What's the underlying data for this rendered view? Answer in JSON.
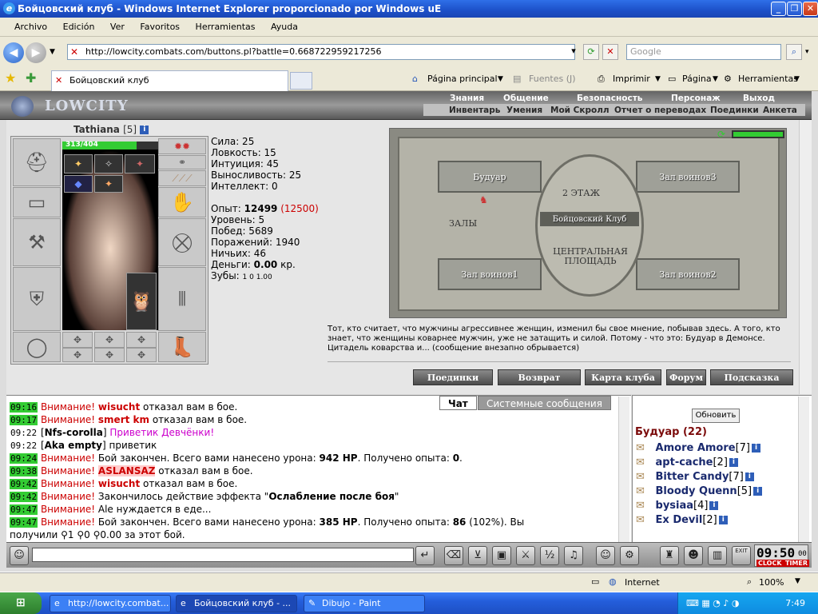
{
  "window": {
    "title": "Бойцовский клуб - Windows Internet Explorer proporcionado por Windows uE"
  },
  "menu": [
    "Archivo",
    "Edición",
    "Ver",
    "Favoritos",
    "Herramientas",
    "Ayuda"
  ],
  "address": {
    "url": "http://lowcity.combats.com/buttons.pl?battle=0.668722959217256",
    "search_placeholder": "Google"
  },
  "tab": {
    "label": "Бойцовский клуб"
  },
  "commandbar": {
    "home": "Página principal",
    "feeds": "Fuentes (J)",
    "print": "Imprimir",
    "page": "Página",
    "tools": "Herramientas"
  },
  "game": {
    "logo": "LOWCITY",
    "topnav": [
      "Знания",
      "Общение",
      "Безопасность",
      "Персонаж",
      "Выход"
    ],
    "subnav": [
      "Инвентарь",
      "Умения",
      "Мой Скролл",
      "Отчет о переводах",
      "Поединки",
      "Анкета"
    ],
    "character": {
      "name": "Tathiana",
      "level": "[5]",
      "hp": "313/404",
      "hp_fraction": 0.775
    },
    "stats": {
      "strength": "Сила: 25",
      "agility": "Ловкость: 15",
      "intuition": "Интуиция: 45",
      "endurance": "Выносливость: 25",
      "intellect": "Интеллект: 0",
      "exp_label": "Опыт:",
      "exp_value": "12499",
      "exp_next": "(12500)",
      "level": "Уровень: 5",
      "wins": "Побед: 5689",
      "losses": "Поражений: 1940",
      "draws": "Ничьих: 46",
      "money_label": "Деньги:",
      "money_value": "0.00",
      "money_unit": "кр.",
      "teeth_label": "Зубы:",
      "teeth_values": "1 0 1.00"
    },
    "map": {
      "rooms": [
        "Будуар",
        "Зал воинов3",
        "2 ЭТАЖ",
        "Бойцовский Клуб",
        "ЗАЛЫ",
        "ЦЕНТРАЛЬНАЯ ПЛОЩАДЬ",
        "Зал воинов1",
        "Зал воинов2"
      ]
    },
    "lore": "Тот, кто считает, что мужчины агрессивнее женщин, изменил бы свое мнение, побывав здесь. А того, кто знает, что женщины коварнее мужчин, уже не затащить и силой. Потому - что это: Будуар в Демонсе. Цитадель коварства и... (сообщение внезапно обрывается)",
    "buttons": [
      "Поединки",
      "Возврат",
      "Карта клуба",
      "Форум",
      "Подсказка"
    ]
  },
  "chat": {
    "tabs": [
      "Чат",
      "Системные сообщения"
    ],
    "lines": [
      {
        "time": "09:16",
        "warn": "Внимание!",
        "nick": "wisucht",
        "text": " отказал вам в бое."
      },
      {
        "time": "09:17",
        "warn": "Внимание!",
        "nick": "smert km",
        "text": " отказал вам в бое."
      },
      {
        "time": "09:22",
        "from": "Nfs-corolla",
        "text": " Приветик Девчёнки!"
      },
      {
        "time": "09:22",
        "from": "Aka empty",
        "text": " приветик"
      },
      {
        "time": "09:24",
        "warn": "Внимание!",
        "text": " Бой закончен. Всего вами нанесено урона: ",
        "b1": "942 HP",
        "t2": ". Получено опыта: ",
        "b2": "0",
        "t3": "."
      },
      {
        "time": "09:38",
        "warn": "Внимание!",
        "nick": "ASLANSAZ",
        "text": " отказал вам в бое."
      },
      {
        "time": "09:42",
        "warn": "Внимание!",
        "nick": "wisucht",
        "text": " отказал вам в бое."
      },
      {
        "time": "09:42",
        "warn": "Внимание!",
        "text": " Закончилось действие эффекта \"",
        "b1": "Ослабление после боя",
        "t2": "\""
      },
      {
        "time": "09:47",
        "warn": "Внимание!",
        "text": " Ale нуждается в еде..."
      },
      {
        "time": "09:47",
        "warn": "Внимание!",
        "text": " Бой закончен. Всего вами нанесено урона: ",
        "b1": "385 HP",
        "t2": ". Получено опыта: ",
        "b2": "86",
        "t3": " (102%). Вы"
      }
    ],
    "last_line": "получили ⚲1 ⚲0 ⚲0.00 за этот бой."
  },
  "users": {
    "refresh": "Обновить",
    "room": "Будуар (22)",
    "list": [
      {
        "name": "Amore Amore",
        "level": "[7]"
      },
      {
        "name": "apt-cache",
        "level": "[2]"
      },
      {
        "name": "Bitter Candy",
        "level": "[7]"
      },
      {
        "name": "Bloody Quenn",
        "level": "[5]"
      },
      {
        "name": "bysiaa",
        "level": "[4]"
      },
      {
        "name": "Ex Devil",
        "level": "[2]"
      }
    ]
  },
  "toolbar": {
    "time": "09:50",
    "seconds": "00",
    "clock_label": "CLOCK",
    "timer_label": "TIMER",
    "exit_label": "EXIT"
  },
  "status": {
    "zone": "Internet",
    "zoom": "100%"
  },
  "taskbar": {
    "tasks": [
      "http://lowcity.combat...",
      "Бойцовский клуб - ...",
      "Dibujo - Paint"
    ],
    "time": "7:49"
  }
}
